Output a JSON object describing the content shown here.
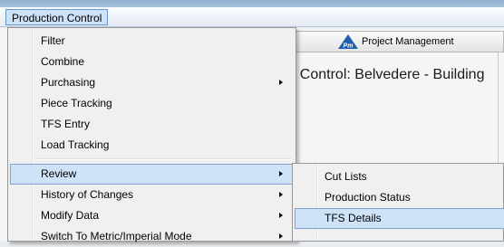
{
  "menubar": {
    "production_control": "Production Control"
  },
  "tabs": {
    "project_management": "Project Management",
    "project_management_logo": "Pm"
  },
  "content": {
    "title": "ion Control: Belvedere - Building"
  },
  "menu": {
    "items": [
      {
        "label": "Filter",
        "has_submenu": false
      },
      {
        "label": "Combine",
        "has_submenu": false
      },
      {
        "label": "Purchasing",
        "has_submenu": true
      },
      {
        "label": "Piece Tracking",
        "has_submenu": false
      },
      {
        "label": "TFS Entry",
        "has_submenu": false
      },
      {
        "label": "Load Tracking",
        "has_submenu": false
      },
      {
        "label": "Review",
        "has_submenu": true,
        "active": true
      },
      {
        "label": "History of Changes",
        "has_submenu": true
      },
      {
        "label": "Modify Data",
        "has_submenu": true
      },
      {
        "label": "Switch To Metric/Imperial Mode",
        "has_submenu": true
      }
    ]
  },
  "submenu": {
    "items": [
      {
        "label": "Cut Lists"
      },
      {
        "label": "Production Status"
      },
      {
        "label": "TFS Details",
        "active": true
      }
    ]
  },
  "colors": {
    "menu_highlight": "#cfe3f8",
    "menu_highlight_border": "#7da2ce",
    "menu_background": "#f0f0f0"
  }
}
